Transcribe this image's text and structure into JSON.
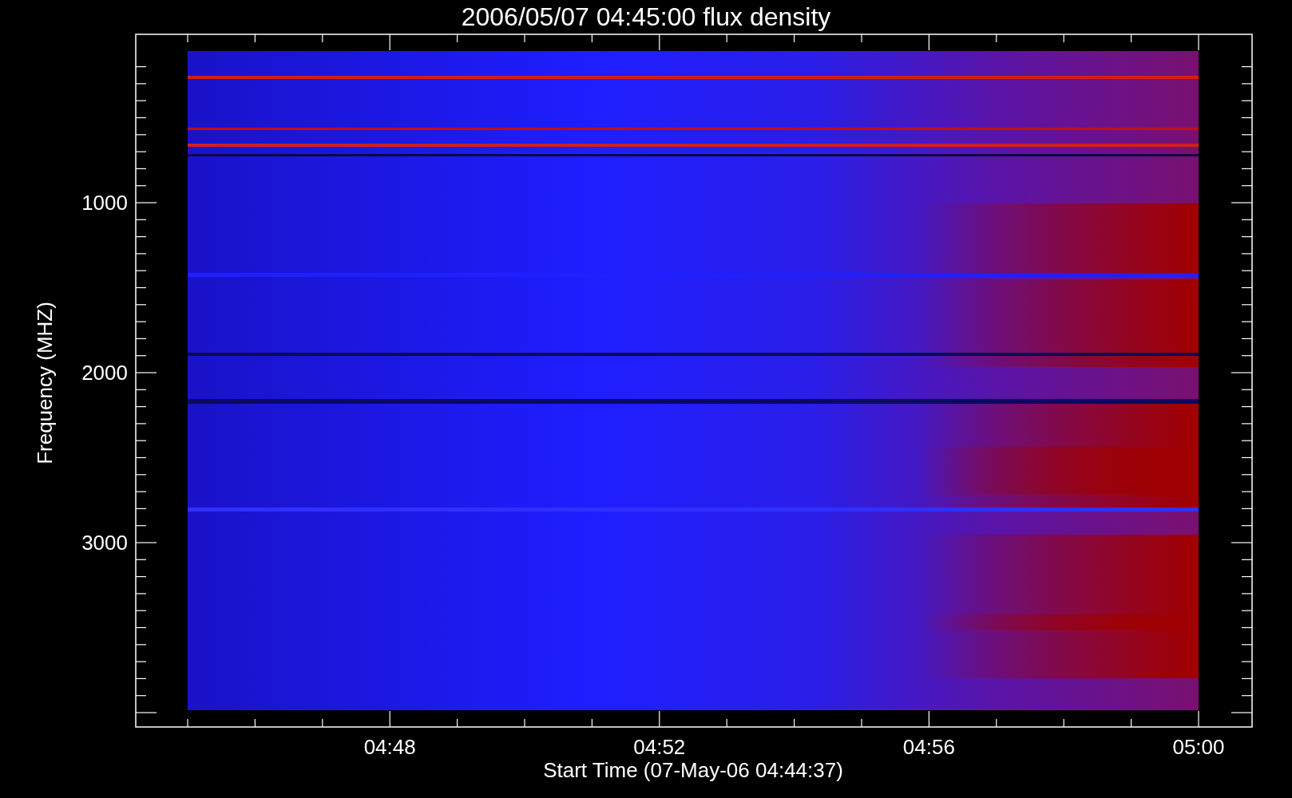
{
  "title": "2006/05/07 04:45:00 flux density",
  "y_axis": {
    "label": "Frequency (MHZ)",
    "ticks": [
      "1000",
      "2000",
      "3000"
    ]
  },
  "x_axis": {
    "label": "Start Time (07-May-06 04:44:37)",
    "ticks": [
      "04:48",
      "04:52",
      "04:56",
      "05:00"
    ]
  }
}
